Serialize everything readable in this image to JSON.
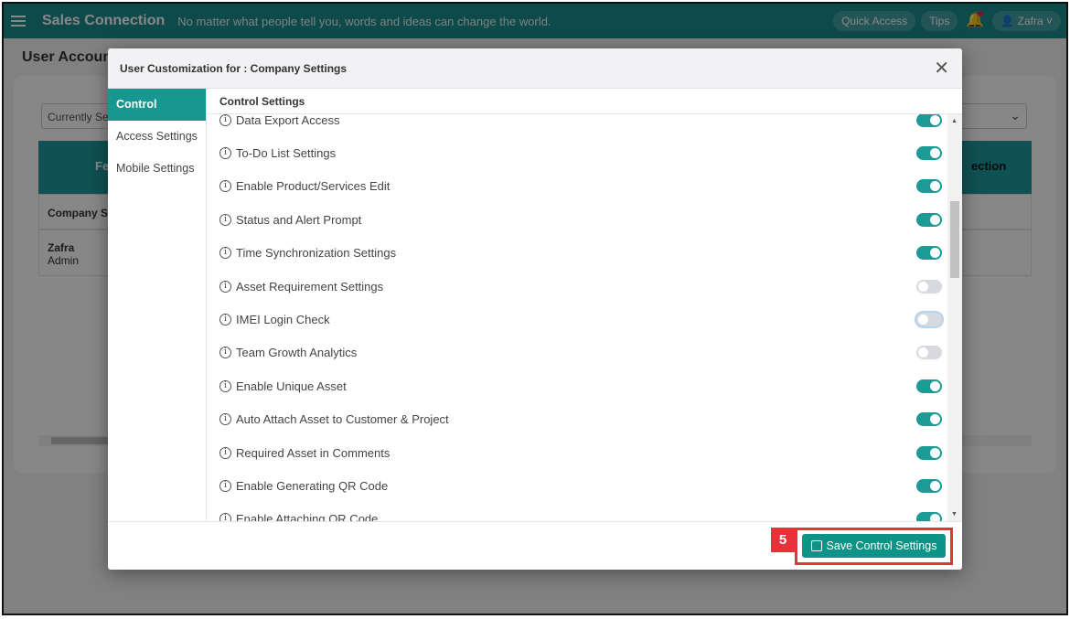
{
  "app": {
    "title": "Sales Connection",
    "tagline": "No matter what people tell you, words and ideas can change the world.",
    "quick_access": "Quick Access",
    "tips": "Tips",
    "user": "Zafra"
  },
  "background": {
    "page_title": "User Account",
    "select_value": "Currently Se",
    "col1": "Fe",
    "col2": "ection",
    "row1": "Company Se",
    "row2_name": "Zafra",
    "row2_role": "Admin"
  },
  "modal": {
    "title": "User Customization for : Company Settings",
    "tabs": [
      {
        "label": "Control Settings",
        "active": true
      },
      {
        "label": "Access Settings"
      },
      {
        "label": "Mobile Settings"
      }
    ],
    "section_title": "Control Settings",
    "items": [
      {
        "label": "Data Export Access",
        "on": true
      },
      {
        "label": "To-Do List Settings",
        "on": true
      },
      {
        "label": "Enable Product/Services Edit",
        "on": true
      },
      {
        "label": "Status and Alert Prompt",
        "on": true
      },
      {
        "label": "Time Synchronization Settings",
        "on": true
      },
      {
        "label": "Asset Requirement Settings",
        "on": false
      },
      {
        "label": "IMEI Login Check",
        "on": false,
        "focused": true
      },
      {
        "label": "Team Growth Analytics",
        "on": false
      },
      {
        "label": "Enable Unique Asset",
        "on": true
      },
      {
        "label": "Auto Attach Asset to Customer & Project",
        "on": true
      },
      {
        "label": "Required Asset in Comments",
        "on": true
      },
      {
        "label": "Enable Generating QR Code",
        "on": true
      },
      {
        "label": "Enable Attaching QR Code",
        "on": true
      }
    ],
    "save_label": "Save Control Settings",
    "step_badge": "5"
  },
  "colors": {
    "accent": "#17978f",
    "highlight": "#e8323a"
  }
}
